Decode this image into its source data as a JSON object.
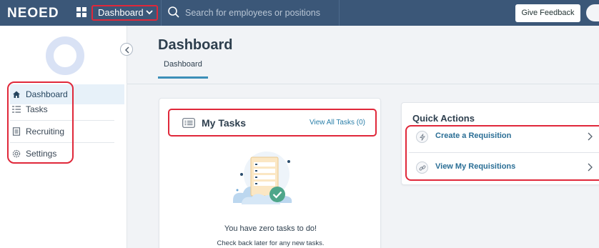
{
  "app": {
    "logo": "NEOED"
  },
  "topbar": {
    "nav_select": "Dashboard",
    "search_placeholder": "Search for employees or positions",
    "feedback_label": "Give Feedback"
  },
  "sidebar": {
    "items": [
      {
        "label": "Dashboard",
        "icon": "home-icon",
        "active": true
      },
      {
        "label": "Tasks",
        "icon": "tasks-list-icon",
        "active": false
      },
      {
        "label": "Recruiting",
        "icon": "document-icon",
        "active": false
      },
      {
        "label": "Settings",
        "icon": "gear-icon",
        "active": false
      }
    ]
  },
  "main": {
    "title": "Dashboard",
    "tabs": [
      {
        "label": "Dashboard",
        "active": true
      }
    ]
  },
  "tasks_card": {
    "title": "My Tasks",
    "view_all": "View All Tasks (0)",
    "empty_title": "You have zero tasks to do!",
    "empty_subtitle": "Check back later for any new tasks."
  },
  "quick_actions": {
    "title": "Quick Actions",
    "items": [
      {
        "label": "Create a Requisition",
        "icon": "lightning-icon"
      },
      {
        "label": "View My Requisitions",
        "icon": "link-icon"
      }
    ]
  },
  "colors": {
    "topbar": "#3b5778",
    "highlight": "#e0283a",
    "accent": "#2a7fa9",
    "active_nav": "#e7f1f9"
  }
}
